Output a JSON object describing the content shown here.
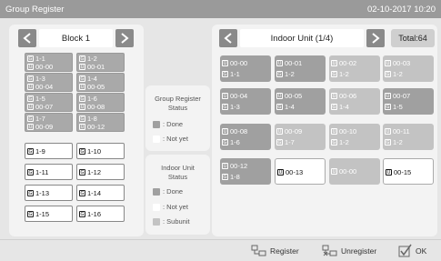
{
  "title": "Group Register",
  "datetime": "02-10-2017  10:20",
  "left": {
    "nav_label": "Block 1",
    "groups": [
      {
        "lines": [
          {
            "icon": "G",
            "text": "1-1"
          },
          {
            "icon": "U",
            "text": "00-00"
          }
        ],
        "done": true
      },
      {
        "lines": [
          {
            "icon": "G",
            "text": "1-2"
          },
          {
            "icon": "U",
            "text": "00-01"
          }
        ],
        "done": true
      },
      {
        "lines": [
          {
            "icon": "G",
            "text": "1-3"
          },
          {
            "icon": "U",
            "text": "00-04"
          }
        ],
        "done": true
      },
      {
        "lines": [
          {
            "icon": "G",
            "text": "1-4"
          },
          {
            "icon": "U",
            "text": "00-05"
          }
        ],
        "done": true
      },
      {
        "lines": [
          {
            "icon": "G",
            "text": "1-5"
          },
          {
            "icon": "U",
            "text": "00-07"
          }
        ],
        "done": true
      },
      {
        "lines": [
          {
            "icon": "G",
            "text": "1-6"
          },
          {
            "icon": "U",
            "text": "00-08"
          }
        ],
        "done": true
      },
      {
        "lines": [
          {
            "icon": "G",
            "text": "1-7"
          },
          {
            "icon": "U",
            "text": "00-09"
          }
        ],
        "done": true
      },
      {
        "lines": [
          {
            "icon": "G",
            "text": "1-8"
          },
          {
            "icon": "U",
            "text": "00-12"
          }
        ],
        "done": true
      },
      {
        "lines": [
          {
            "icon": "G",
            "text": "1-9"
          }
        ],
        "done": false
      },
      {
        "lines": [
          {
            "icon": "G",
            "text": "1-10"
          }
        ],
        "done": false
      },
      {
        "lines": [
          {
            "icon": "G",
            "text": "1-11"
          }
        ],
        "done": false
      },
      {
        "lines": [
          {
            "icon": "G",
            "text": "1-12"
          }
        ],
        "done": false
      },
      {
        "lines": [
          {
            "icon": "G",
            "text": "1-13"
          }
        ],
        "done": false
      },
      {
        "lines": [
          {
            "icon": "G",
            "text": "1-14"
          }
        ],
        "done": false
      },
      {
        "lines": [
          {
            "icon": "G",
            "text": "1-15"
          }
        ],
        "done": false
      },
      {
        "lines": [
          {
            "icon": "G",
            "text": "1-16"
          }
        ],
        "done": false
      }
    ]
  },
  "right": {
    "nav_label": "Indoor Unit (1/4)",
    "total": "Total:64",
    "units": [
      {
        "lines": [
          {
            "icon": "U",
            "text": "00-00"
          },
          {
            "icon": "G",
            "text": "1-1"
          }
        ],
        "style": "g1"
      },
      {
        "lines": [
          {
            "icon": "U",
            "text": "00-01"
          },
          {
            "icon": "G",
            "text": "1-2"
          }
        ],
        "style": "g1"
      },
      {
        "lines": [
          {
            "icon": "U",
            "text": "00-02"
          },
          {
            "icon": "G",
            "text": "1-2"
          }
        ],
        "style": "g2"
      },
      {
        "lines": [
          {
            "icon": "U",
            "text": "00-03"
          },
          {
            "icon": "G",
            "text": "1-2"
          }
        ],
        "style": "g2"
      },
      {
        "lines": [
          {
            "icon": "U",
            "text": "00-04"
          },
          {
            "icon": "G",
            "text": "1-3"
          }
        ],
        "style": "g1"
      },
      {
        "lines": [
          {
            "icon": "U",
            "text": "00-05"
          },
          {
            "icon": "G",
            "text": "1-4"
          }
        ],
        "style": "g1"
      },
      {
        "lines": [
          {
            "icon": "U",
            "text": "00-06"
          },
          {
            "icon": "G",
            "text": "1-4"
          }
        ],
        "style": "g2"
      },
      {
        "lines": [
          {
            "icon": "U",
            "text": "00-07"
          },
          {
            "icon": "G",
            "text": "1-5"
          }
        ],
        "style": "g1"
      },
      {
        "lines": [
          {
            "icon": "U",
            "text": "00-08"
          },
          {
            "icon": "G",
            "text": "1-6"
          }
        ],
        "style": "g1"
      },
      {
        "lines": [
          {
            "icon": "U",
            "text": "00-09"
          },
          {
            "icon": "G",
            "text": "1-7"
          }
        ],
        "style": "g2"
      },
      {
        "lines": [
          {
            "icon": "U",
            "text": "00-10"
          },
          {
            "icon": "G",
            "text": "1-2"
          }
        ],
        "style": "g2"
      },
      {
        "lines": [
          {
            "icon": "U",
            "text": "00-11"
          },
          {
            "icon": "G",
            "text": "1-2"
          }
        ],
        "style": "g2"
      },
      {
        "lines": [
          {
            "icon": "U",
            "text": "00-12"
          },
          {
            "icon": "G",
            "text": "1-8"
          }
        ],
        "style": "g1"
      },
      {
        "lines": [
          {
            "icon": "U",
            "text": "00-13"
          }
        ],
        "style": "w"
      },
      {
        "lines": [
          {
            "icon": "U",
            "text": "00-00"
          }
        ],
        "style": "g2"
      },
      {
        "lines": [
          {
            "icon": "U",
            "text": "00-15"
          }
        ],
        "style": "w"
      }
    ]
  },
  "status_group": {
    "title_line1": "Group Register",
    "title_line2": "Status",
    "done": ": Done",
    "notyet": ": Not yet"
  },
  "status_unit": {
    "title_line1": "Indoor Unit",
    "title_line2": "Status",
    "done": ": Done",
    "notyet": ": Not yet",
    "subunit": ": Subunit"
  },
  "bottom": {
    "register": "Register",
    "unregister": "Unregister",
    "ok": "OK"
  },
  "colors": {
    "done": "#a0a0a0",
    "subunit": "#c3c3c3",
    "notyet": "#ffffff"
  }
}
